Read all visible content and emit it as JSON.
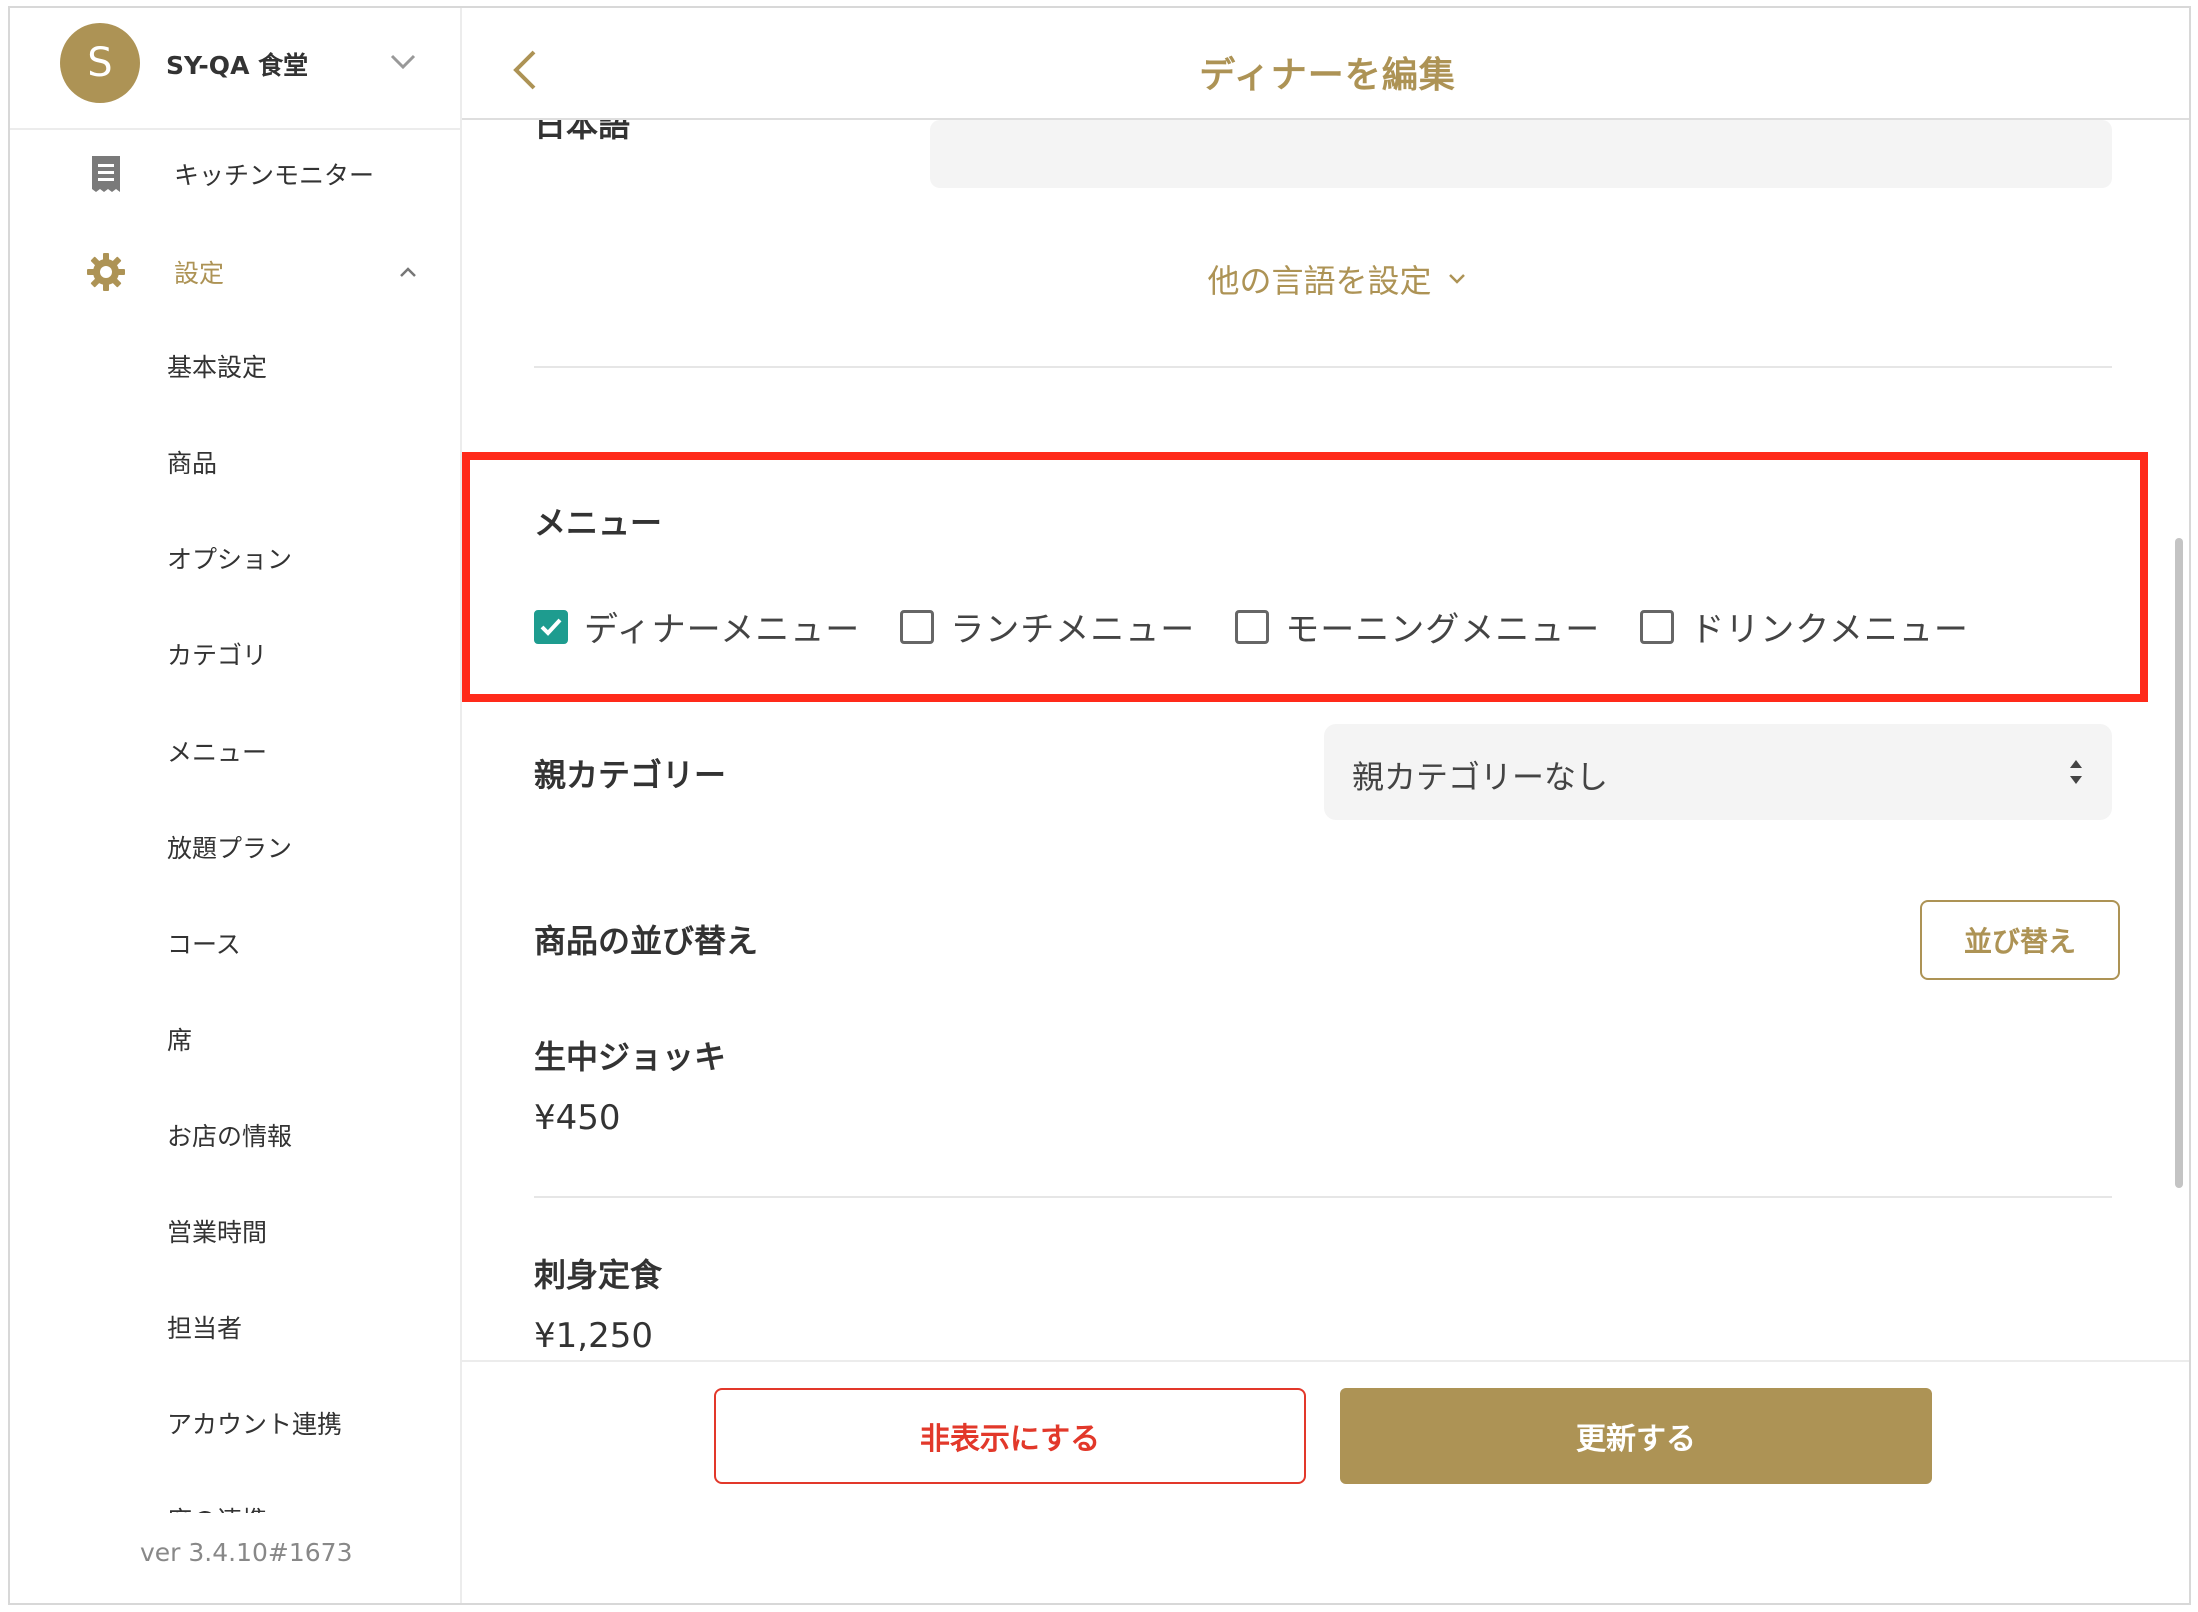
{
  "store": {
    "avatar_letter": "S",
    "name": "SY-QA 食堂"
  },
  "sidebar": {
    "kitchen_monitor": "キッチンモニター",
    "settings": "設定",
    "sub_items": [
      "基本設定",
      "商品",
      "オプション",
      "カテゴリ",
      "メニュー",
      "放題プラン",
      "コース",
      "席",
      "お店の情報",
      "営業時間",
      "担当者",
      "アカウント連携",
      "席の連携"
    ],
    "version": "ver 3.4.10#1673"
  },
  "header": {
    "title": "ディナーを編集"
  },
  "form": {
    "language_label": "日本語",
    "other_languages": "他の言語を設定",
    "menu_section_title": "メニュー",
    "menus": [
      {
        "label": "ディナーメニュー",
        "checked": true
      },
      {
        "label": "ランチメニュー",
        "checked": false
      },
      {
        "label": "モーニングメニュー",
        "checked": false
      },
      {
        "label": "ドリンクメニュー",
        "checked": false
      }
    ],
    "parent_category_label": "親カテゴリー",
    "parent_category_value": "親カテゴリーなし",
    "sort_label": "商品の並び替え",
    "sort_button": "並び替え",
    "products": [
      {
        "name": "生中ジョッキ",
        "price": "¥450"
      },
      {
        "name": "刺身定食",
        "price": "¥1,250"
      }
    ]
  },
  "footer": {
    "hide_button": "非表示にする",
    "update_button": "更新する"
  },
  "colors": {
    "accent": "#ad9355",
    "danger": "#e2382a",
    "check": "#1e9c8f",
    "highlight": "#ff2a1a"
  }
}
